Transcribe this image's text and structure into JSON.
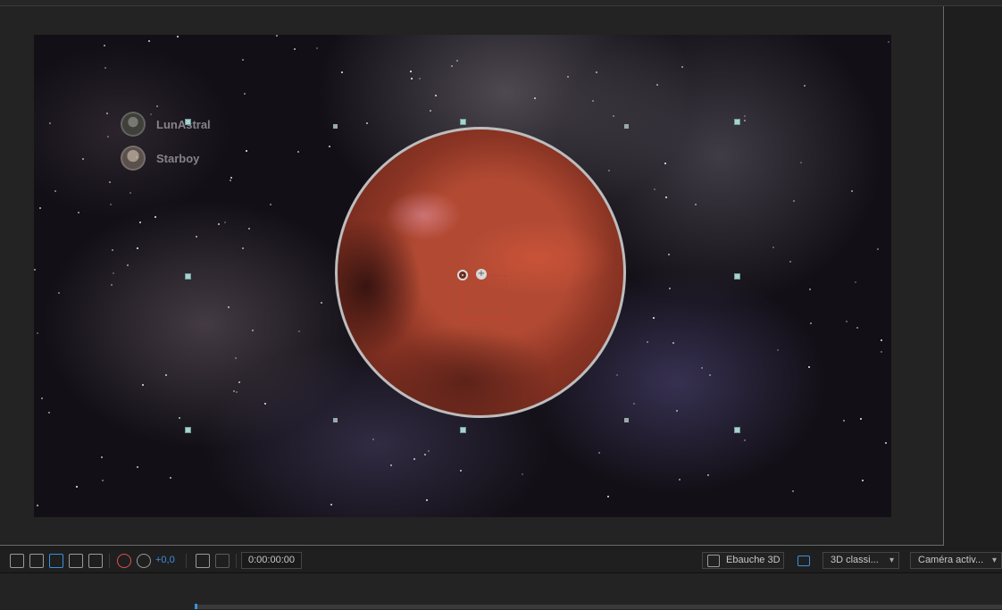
{
  "composition": {
    "users": [
      {
        "name": "LunAstral"
      },
      {
        "name": "Starboy"
      }
    ]
  },
  "toolbar": {
    "icons": [
      "fast-preview-icon",
      "transparency-grid-icon",
      "mask-path-icon",
      "region-of-interest-icon",
      "guides-icon",
      "color-channels-icon",
      "exposure-icon",
      "snapshot-icon",
      "show-snapshot-icon"
    ],
    "exposure_value": "+0,0",
    "timecode": "0:00:00:00",
    "renderer_label": "Ebauche 3D",
    "view_select": "3D classi...",
    "camera_select": "Caméra activ...",
    "accent_color": "#3d8fe0"
  }
}
